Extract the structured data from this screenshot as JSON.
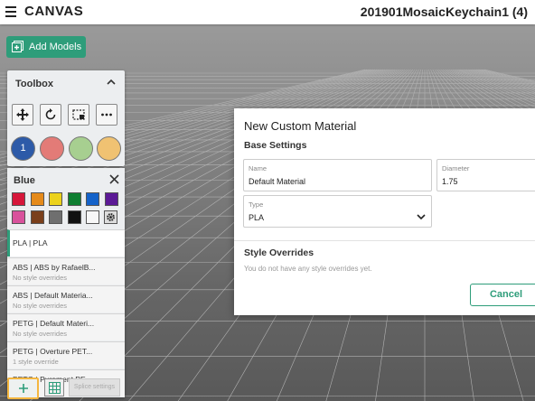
{
  "header": {
    "app_name": "CANVAS",
    "project_name": "201901MosaicKeychain1 (4)"
  },
  "actions": {
    "add_models": "Add Models"
  },
  "toolbox": {
    "title": "Toolbox",
    "extruders": [
      {
        "label": "1",
        "color": "#2d5aa8"
      },
      {
        "label": "",
        "color": "#e37b77"
      },
      {
        "label": "",
        "color": "#a7cf90"
      },
      {
        "label": "",
        "color": "#f0c272"
      }
    ],
    "tools": [
      "move-icon",
      "rotate-icon",
      "select-icon",
      "more-icon"
    ]
  },
  "color_panel": {
    "title": "Blue",
    "swatches": [
      "#d6163a",
      "#e58a1a",
      "#ecd21c",
      "#0e7e31",
      "#1462c9",
      "#5c1a96",
      "#d9529c",
      "#7a3f1b",
      "#6f6f6f",
      "#111111",
      "#f7f7f7"
    ],
    "materials": [
      {
        "name": "PLA | PLA",
        "style": "",
        "selected": true
      },
      {
        "name": "ABS | ABS by RafaelB...",
        "style": "No style overrides"
      },
      {
        "name": "ABS | Default Materia...",
        "style": "No style overrides"
      },
      {
        "name": "PETG | Default Materi...",
        "style": "No style overrides"
      },
      {
        "name": "PETG | Overture PET...",
        "style": "1 style override"
      },
      {
        "name": "PETG | Purement PE...",
        "style": ""
      }
    ],
    "splice_settings": "Splice settings"
  },
  "modal": {
    "title": "New Custom Material",
    "base_settings": "Base Settings",
    "name_label": "Name",
    "name_value": "Default Material",
    "diameter_label": "Diameter",
    "diameter_value": "1.75",
    "type_label": "Type",
    "type_value": "PLA",
    "style_overrides": "Style Overrides",
    "no_overrides": "You do not have any style overrides yet.",
    "cancel": "Cancel"
  },
  "colors": {
    "accent": "#2e9d7a",
    "highlight": "#f4b63f"
  }
}
